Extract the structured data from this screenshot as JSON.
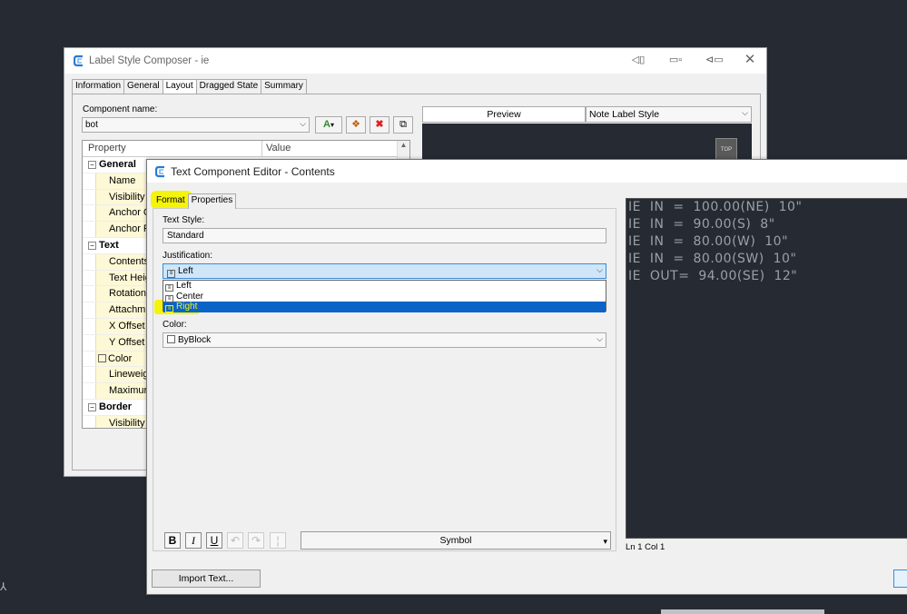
{
  "lsc": {
    "title": "Label Style Composer - ie",
    "tabs": [
      "Information",
      "General",
      "Layout",
      "Dragged State",
      "Summary"
    ],
    "component_name_label": "Component name:",
    "component_name_value": "bot",
    "grid_headers": {
      "property": "Property",
      "value": "Value"
    },
    "rows": [
      {
        "kind": "cat",
        "label": "General"
      },
      {
        "kind": "item",
        "label": "Name"
      },
      {
        "kind": "item",
        "label": "Visibility"
      },
      {
        "kind": "item",
        "label": "Anchor C"
      },
      {
        "kind": "item",
        "label": "Anchor P"
      },
      {
        "kind": "cat",
        "label": "Text"
      },
      {
        "kind": "item",
        "label": "Contents"
      },
      {
        "kind": "item",
        "label": "Text Heig"
      },
      {
        "kind": "item",
        "label": "Rotation"
      },
      {
        "kind": "item",
        "label": "Attachm"
      },
      {
        "kind": "item",
        "label": "X Offset"
      },
      {
        "kind": "item",
        "label": "Y Offset"
      },
      {
        "kind": "item-check",
        "label": "Color"
      },
      {
        "kind": "item",
        "label": "Lineweig"
      },
      {
        "kind": "item",
        "label": "Maximur"
      },
      {
        "kind": "cat",
        "label": "Border"
      },
      {
        "kind": "item",
        "label": "Visibility"
      }
    ],
    "preview_label": "Preview",
    "preview_style": "Note Label Style",
    "viewcube_label": "TOP"
  },
  "tce": {
    "title": "Text Component Editor - Contents",
    "tabs": {
      "format": "Format",
      "properties": "Properties"
    },
    "text_style_label": "Text Style:",
    "text_style_value": "Standard",
    "justification_label": "Justification:",
    "justification_value": "Left",
    "justification_options": [
      "Left",
      "Center",
      "Right"
    ],
    "color_label": "Color:",
    "color_value": "ByBlock",
    "format_buttons": {
      "bold": "B",
      "italic": "I",
      "underline": "U"
    },
    "symbol_label": "Symbol",
    "text_lines": [
      "IE  IN  =  100.00(NE)  10\"",
      "IE  IN  =  90.00(S)  8\"",
      "IE  IN  =  80.00(W)  10\"",
      "IE  IN  =  80.00(SW)  10\"",
      "IE  OUT=  94.00(SE)  12\""
    ],
    "status": "Ln 1 Col 1",
    "import_label": "Import Text..."
  },
  "colors": {
    "highlight": "#f4f40a",
    "selection": "#0a64c8",
    "canvas": "#262a33"
  }
}
